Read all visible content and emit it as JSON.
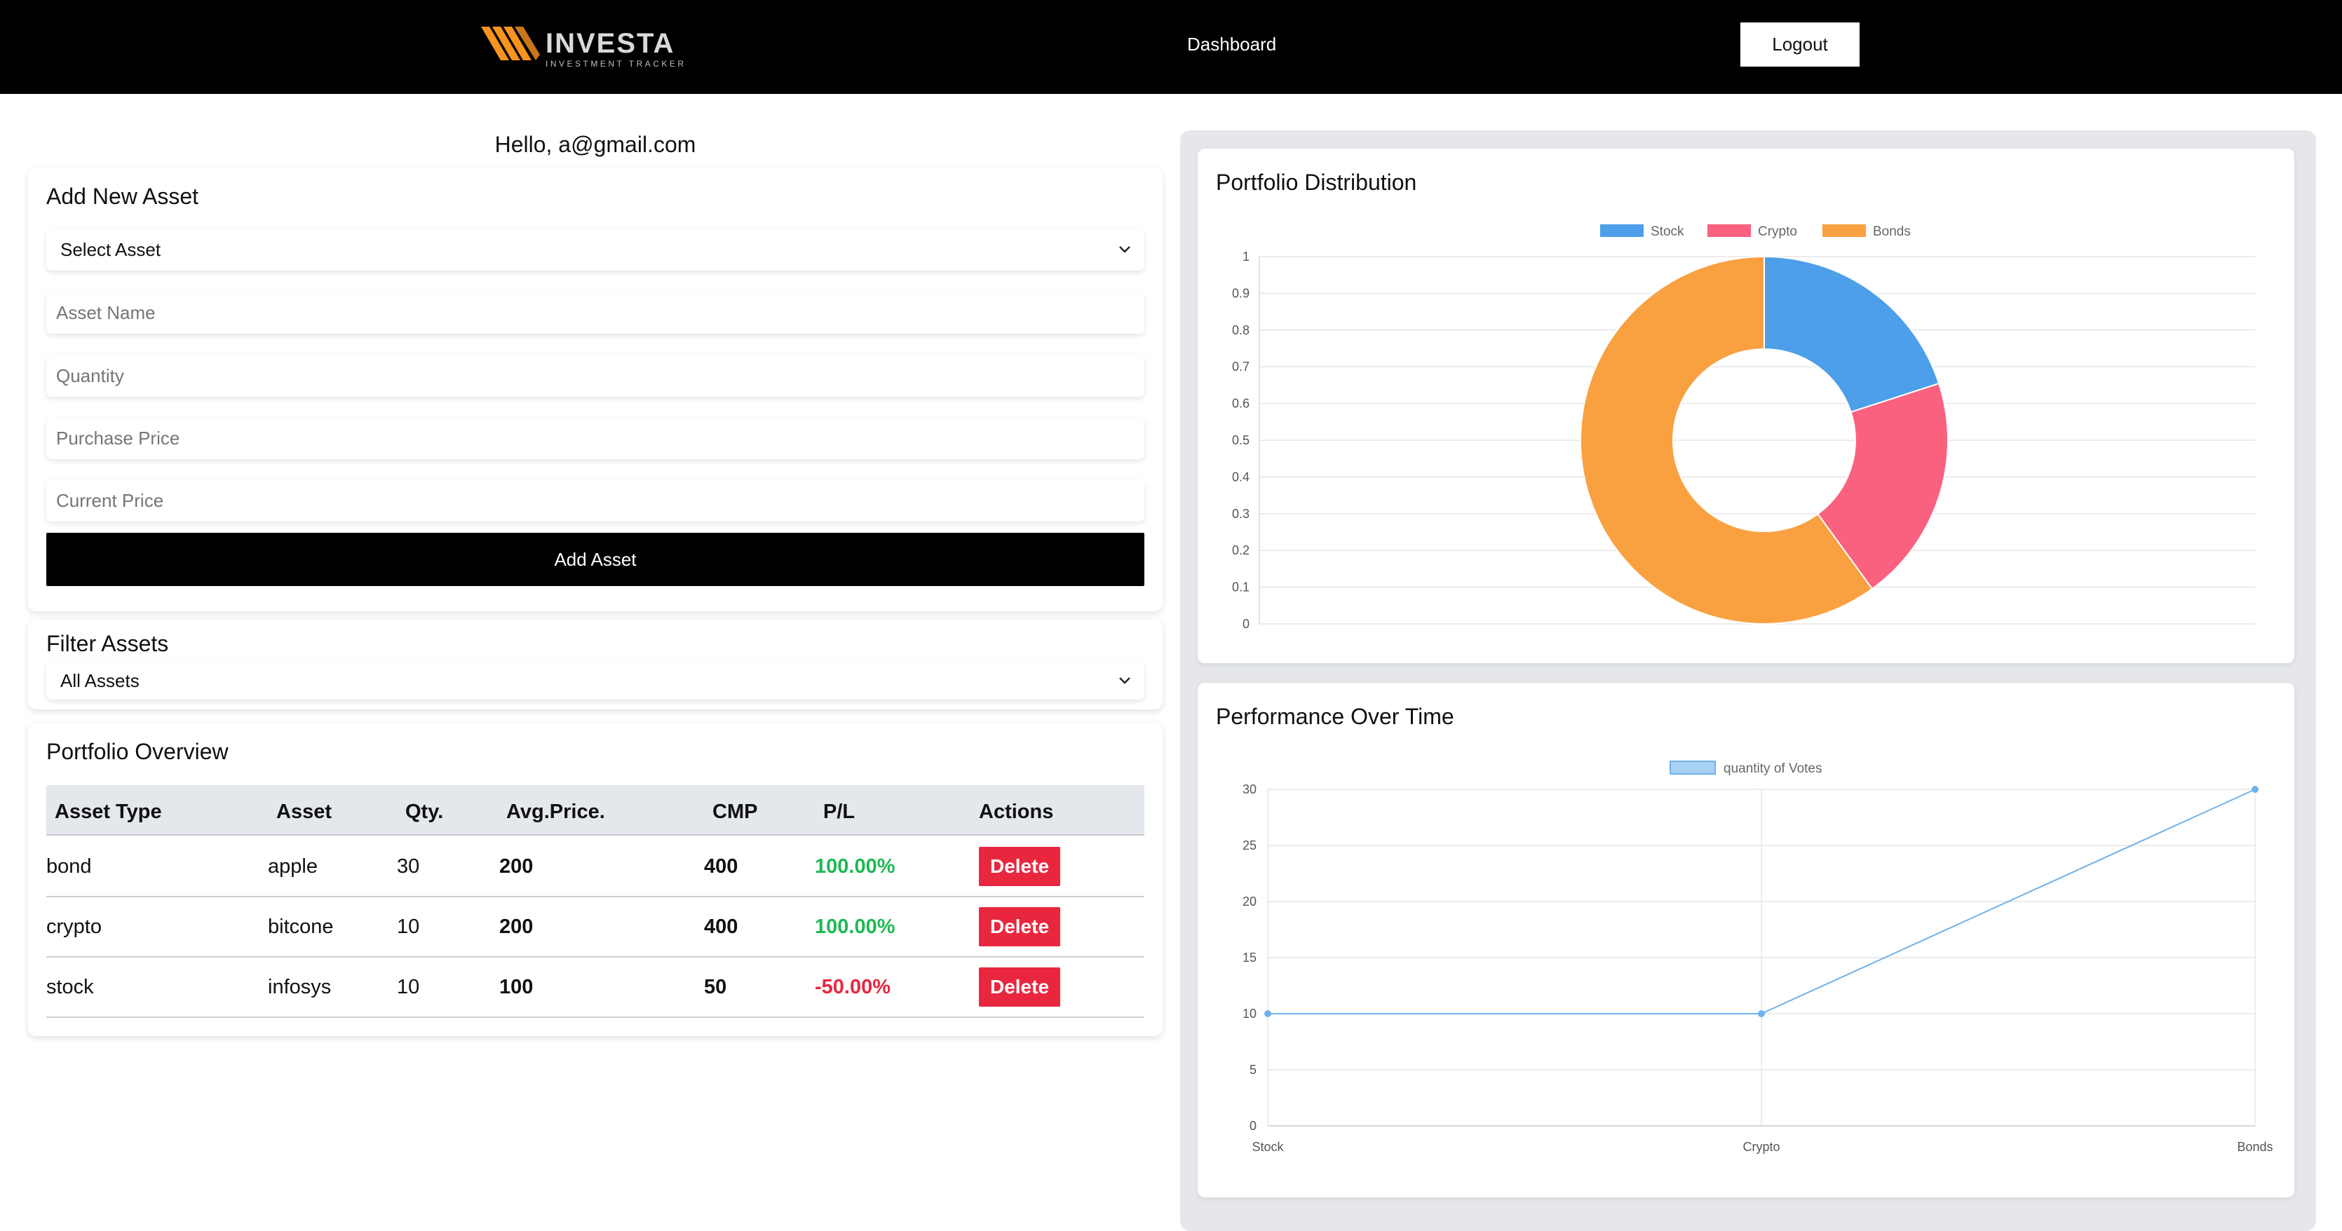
{
  "header": {
    "logo_title": "INVESTA",
    "logo_subtitle": "INVESTMENT TRACKER",
    "nav_dashboard": "Dashboard",
    "logout_label": "Logout"
  },
  "greeting": "Hello, a@gmail.com",
  "add_asset": {
    "title": "Add New Asset",
    "select_value": "Select Asset",
    "name_placeholder": "Asset Name",
    "quantity_placeholder": "Quantity",
    "purchase_price_placeholder": "Purchase Price",
    "current_price_placeholder": "Current Price",
    "submit_label": "Add Asset"
  },
  "filter": {
    "title": "Filter Assets",
    "selected": "All Assets"
  },
  "overview": {
    "title": "Portfolio Overview",
    "columns": [
      "Asset Type",
      "Asset",
      "Qty.",
      "Avg.Price.",
      "CMP",
      "P/L",
      "Actions"
    ],
    "rows": [
      {
        "type": "bond",
        "asset": "apple",
        "qty": "30",
        "avg": "200",
        "cmp": "400",
        "pl": "100.00%",
        "pl_sign": "pos",
        "action": "Delete"
      },
      {
        "type": "crypto",
        "asset": "bitcone",
        "qty": "10",
        "avg": "200",
        "cmp": "400",
        "pl": "100.00%",
        "pl_sign": "pos",
        "action": "Delete"
      },
      {
        "type": "stock",
        "asset": "infosys",
        "qty": "10",
        "avg": "100",
        "cmp": "50",
        "pl": "-50.00%",
        "pl_sign": "neg",
        "action": "Delete"
      }
    ]
  },
  "colors": {
    "stock": "#4c9fe8",
    "crypto": "#f9617f",
    "bonds": "#f9a141",
    "positive": "#1db954",
    "negative": "#e8273f",
    "line": "#6fb2ea"
  },
  "chart_data": [
    {
      "type": "pie",
      "title": "Portfolio Distribution",
      "categories": [
        "Stock",
        "Crypto",
        "Bonds"
      ],
      "values": [
        10,
        10,
        30
      ],
      "yticks": [
        "0",
        "0.1",
        "0.2",
        "0.3",
        "0.4",
        "0.5",
        "0.6",
        "0.7",
        "0.8",
        "0.9",
        "1"
      ],
      "ylim": [
        0,
        1
      ],
      "legend": "top"
    },
    {
      "type": "line",
      "title": "Performance Over Time",
      "categories": [
        "Stock",
        "Crypto",
        "Bonds"
      ],
      "series": [
        {
          "name": "quantity of Votes",
          "values": [
            10,
            10,
            30
          ]
        }
      ],
      "yticks": [
        "0",
        "5",
        "10",
        "15",
        "20",
        "25",
        "30"
      ],
      "ylim": [
        0,
        30
      ],
      "grid": true,
      "legend": "top"
    }
  ]
}
